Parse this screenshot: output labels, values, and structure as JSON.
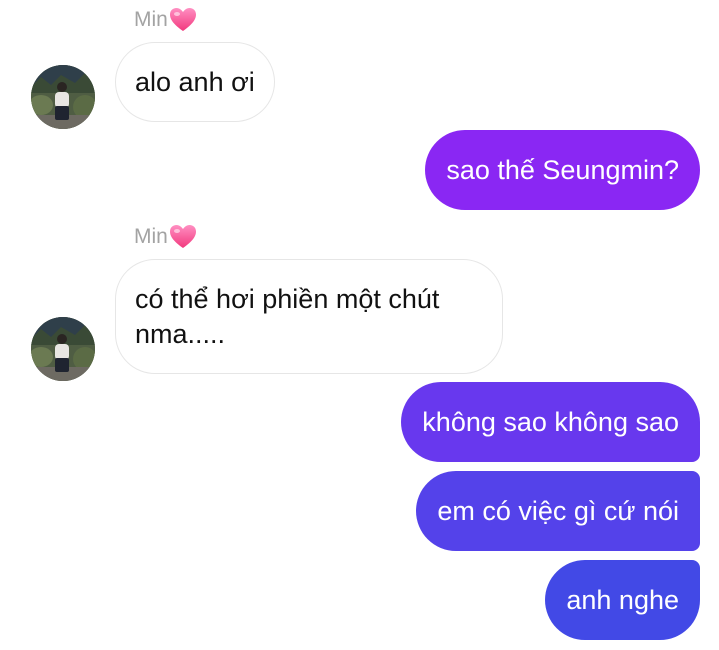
{
  "conversation": {
    "contact_name": "Min",
    "contact_name_icon": "pink-heart-icon",
    "colors": {
      "outgoing_top": "#8a27f3",
      "outgoing_bottom": "#3d4fe6",
      "incoming_bg": "#ffffff",
      "incoming_border": "#e6e6e6",
      "name_color": "#a3a3a3"
    },
    "messages": [
      {
        "from": "contact",
        "text": "alo anh ơi"
      },
      {
        "from": "me",
        "text": "sao thế Seungmin?"
      },
      {
        "from": "contact",
        "text": "có thể hơi phiền một chút nma....."
      },
      {
        "from": "me",
        "text": "không sao không sao"
      },
      {
        "from": "me",
        "text": "em có việc gì cứ nói"
      },
      {
        "from": "me",
        "text": "anh nghe"
      }
    ]
  }
}
